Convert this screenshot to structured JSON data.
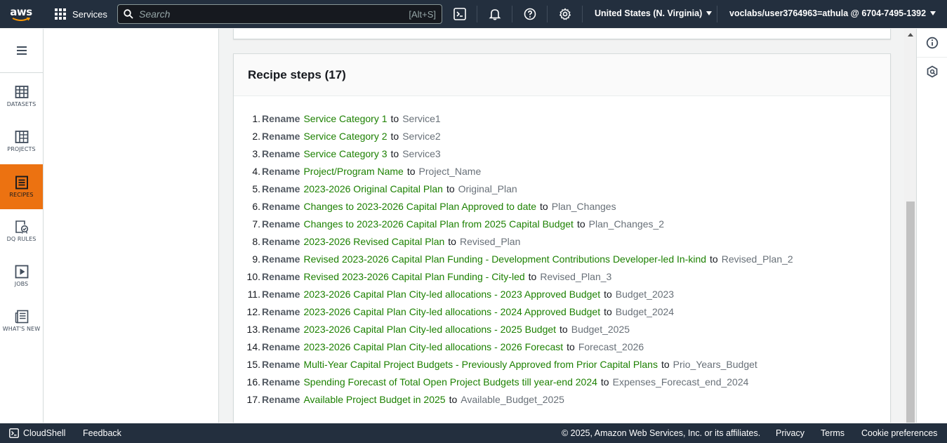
{
  "topnav": {
    "logo": "aws",
    "services_label": "Services",
    "search_placeholder": "Search",
    "search_shortcut": "[Alt+S]",
    "region": "United States (N. Virginia)",
    "account": "voclabs/user3764963=athula @ 6704-7495-1392"
  },
  "rail": {
    "items": [
      {
        "label": "DATASETS",
        "icon": "datasets-icon",
        "active": false
      },
      {
        "label": "PROJECTS",
        "icon": "projects-icon",
        "active": false
      },
      {
        "label": "RECIPES",
        "icon": "recipes-icon",
        "active": true
      },
      {
        "label": "DQ RULES",
        "icon": "dq-rules-icon",
        "active": false
      },
      {
        "label": "JOBS",
        "icon": "jobs-icon",
        "active": false
      },
      {
        "label": "WHAT'S NEW",
        "icon": "whats-new-icon",
        "active": false
      }
    ]
  },
  "recipe": {
    "title": "Recipe steps (17)",
    "steps": [
      {
        "num": "1.",
        "verb": "Rename",
        "from": "Service Category 1",
        "to": "to",
        "dest": "Service1"
      },
      {
        "num": "2.",
        "verb": "Rename",
        "from": "Service Category 2",
        "to": "to",
        "dest": "Service2"
      },
      {
        "num": "3.",
        "verb": "Rename",
        "from": "Service Category 3",
        "to": "to",
        "dest": "Service3"
      },
      {
        "num": "4.",
        "verb": "Rename",
        "from": "Project/Program Name",
        "to": "to",
        "dest": "Project_Name"
      },
      {
        "num": "5.",
        "verb": "Rename",
        "from": "2023-2026 Original Capital Plan",
        "to": "to",
        "dest": "Original_Plan"
      },
      {
        "num": "6.",
        "verb": "Rename",
        "from": "Changes to 2023-2026 Capital Plan Approved to date",
        "to": "to",
        "dest": "Plan_Changes"
      },
      {
        "num": "7.",
        "verb": "Rename",
        "from": "Changes to 2023-2026 Capital Plan from 2025 Capital Budget",
        "to": "to",
        "dest": "Plan_Changes_2"
      },
      {
        "num": "8.",
        "verb": "Rename",
        "from": "2023-2026 Revised Capital Plan",
        "to": "to",
        "dest": "Revised_Plan"
      },
      {
        "num": "9.",
        "verb": "Rename",
        "from": "Revised 2023-2026 Capital Plan Funding - Development Contributions Developer-led In-kind",
        "to": "to",
        "dest": "Revised_Plan_2"
      },
      {
        "num": "10.",
        "verb": "Rename",
        "from": "Revised 2023-2026 Capital Plan Funding - City-led",
        "to": "to",
        "dest": "Revised_Plan_3"
      },
      {
        "num": "11.",
        "verb": "Rename",
        "from": "2023-2026 Capital Plan City-led allocations - 2023 Approved Budget",
        "to": "to",
        "dest": "Budget_2023"
      },
      {
        "num": "12.",
        "verb": "Rename",
        "from": "2023-2026 Capital Plan City-led allocations - 2024 Approved Budget",
        "to": "to",
        "dest": "Budget_2024"
      },
      {
        "num": "13.",
        "verb": "Rename",
        "from": "2023-2026 Capital Plan City-led allocations - 2025 Budget",
        "to": "to",
        "dest": "Budget_2025"
      },
      {
        "num": "14.",
        "verb": "Rename",
        "from": "2023-2026 Capital Plan City-led allocations - 2026 Forecast",
        "to": "to",
        "dest": "Forecast_2026"
      },
      {
        "num": "15.",
        "verb": "Rename",
        "from": "Multi-Year Capital Project Budgets - Previously Approved from Prior Capital Plans",
        "to": "to",
        "dest": "Prio_Years_Budget"
      },
      {
        "num": "16.",
        "verb": "Rename",
        "from": "Spending Forecast of Total Open Project Budgets till year-end 2024",
        "to": "to",
        "dest": "Expenses_Forecast_end_2024"
      },
      {
        "num": "17.",
        "verb": "Rename",
        "from": "Available Project Budget in 2025",
        "to": "to",
        "dest": "Available_Budget_2025"
      }
    ]
  },
  "footer": {
    "cloudshell": "CloudShell",
    "feedback": "Feedback",
    "copyright": "© 2025, Amazon Web Services, Inc. or its affiliates.",
    "privacy": "Privacy",
    "terms": "Terms",
    "cookies": "Cookie preferences"
  },
  "colors": {
    "nav_bg": "#232f3e",
    "active_rail": "#ec7211",
    "source_column": "#1d8102",
    "dest_column": "#687078"
  }
}
